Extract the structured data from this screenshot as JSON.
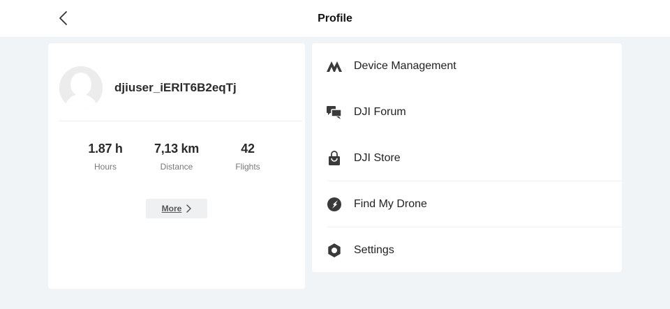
{
  "header": {
    "title": "Profile",
    "back_icon": "chevron-left-icon"
  },
  "profile": {
    "username": "djiuser_iERlT6B2eqTj",
    "avatar_icon": "default-avatar-icon",
    "stats": [
      {
        "value": "1.87 h",
        "label": "Hours"
      },
      {
        "value": "7,13 km",
        "label": "Distance"
      },
      {
        "value": "42",
        "label": "Flights"
      }
    ],
    "more_label": "More"
  },
  "menu": {
    "items": [
      {
        "label": "Device Management",
        "icon": "device-management-icon"
      },
      {
        "label": "DJI Forum",
        "icon": "forum-icon"
      },
      {
        "label": "DJI Store",
        "icon": "store-bag-icon"
      },
      {
        "label": "Find My Drone",
        "icon": "find-drone-icon"
      },
      {
        "label": "Settings",
        "icon": "settings-icon"
      }
    ]
  },
  "colors": {
    "background": "#f1f4f6",
    "card": "#ffffff",
    "icon": "#3a3a3a",
    "text": "#222222",
    "muted": "#777777"
  }
}
